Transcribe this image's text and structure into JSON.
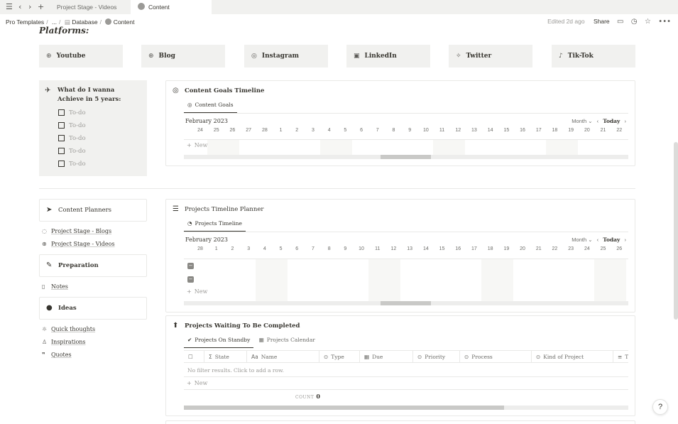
{
  "tabs": [
    {
      "label": "Project Stage - Videos",
      "active": false
    },
    {
      "label": "Content",
      "active": true
    }
  ],
  "breadcrumb": {
    "items": [
      "Pro Templates",
      "...",
      "Database",
      "Content"
    ]
  },
  "topbar": {
    "edited": "Edited 2d ago",
    "share": "Share"
  },
  "platforms": {
    "title": "Platforms:",
    "buttons": [
      {
        "label": "Youtube",
        "icon": "globe-icon"
      },
      {
        "label": "Blog",
        "icon": "globe-icon"
      },
      {
        "label": "Instagram",
        "icon": "instagram-icon"
      },
      {
        "label": "LinkedIn",
        "icon": "linkedin-icon"
      },
      {
        "label": "Twitter",
        "icon": "twitter-icon"
      },
      {
        "label": "Tik-Tok",
        "icon": "tiktok-icon"
      }
    ]
  },
  "goals": {
    "title": "What do I wanna Achieve in 5 years:",
    "todos": [
      "To-do",
      "To-do",
      "To-do",
      "To-do",
      "To-do"
    ]
  },
  "content_goals": {
    "title": "Content Goals Timeline",
    "view_tab": "Content Goals",
    "month": "February 2023",
    "scale": "Month",
    "today": "Today",
    "days": [
      "",
      "24",
      "25",
      "26",
      "27",
      "28",
      "1",
      "2",
      "3",
      "4",
      "5",
      "6",
      "7",
      "8",
      "9",
      "10",
      "11",
      "12",
      "13",
      "14",
      "15",
      "16",
      "17",
      "18",
      "19",
      "20",
      "21",
      "22"
    ],
    "new_label": "New"
  },
  "sidebar": {
    "content_planners": "Content Planners",
    "links1": [
      {
        "label": "Project Stage - Blogs",
        "icon": "dashed-circle-icon"
      },
      {
        "label": "Project Stage - Videos",
        "icon": "globe-icon"
      }
    ],
    "preparation": "Preparation",
    "links2": [
      {
        "label": "Notes",
        "icon": "clipboard-icon"
      }
    ],
    "ideas": "Ideas",
    "links3": [
      {
        "label": "Quick thoughts",
        "icon": "lightbulb-icon"
      },
      {
        "label": "Inspirations",
        "icon": "person-icon"
      },
      {
        "label": "Quotes",
        "icon": "quote-icon"
      }
    ]
  },
  "projects_timeline": {
    "title": "Projects Timeline Planner",
    "view_tab": "Projects Timeline",
    "month": "February 2023",
    "scale": "Month",
    "today": "Today",
    "days": [
      "",
      "28",
      "1",
      "2",
      "3",
      "4",
      "5",
      "6",
      "7",
      "8",
      "9",
      "10",
      "11",
      "12",
      "13",
      "14",
      "15",
      "16",
      "17",
      "18",
      "19",
      "20",
      "21",
      "22",
      "23",
      "24",
      "25",
      "26"
    ],
    "new_label": "New"
  },
  "waiting": {
    "title": "Projects Waiting To Be Completed",
    "view_tabs": [
      "Projects On Standby",
      "Projects Calendar"
    ],
    "columns": [
      {
        "label": "State",
        "icon": "sigma-icon"
      },
      {
        "label": "Name",
        "icon": "text-icon"
      },
      {
        "label": "Type",
        "icon": "select-icon"
      },
      {
        "label": "Due",
        "icon": "calendar-icon"
      },
      {
        "label": "Priority",
        "icon": "select-icon"
      },
      {
        "label": "Process",
        "icon": "select-icon"
      },
      {
        "label": "Kind of Project",
        "icon": "select-icon"
      },
      {
        "label": "T",
        "icon": "list-icon"
      }
    ],
    "empty": "No filter results. Click to add a row.",
    "new_label": "New",
    "count_label": "COUNT",
    "count_value": "0"
  },
  "help": "?"
}
